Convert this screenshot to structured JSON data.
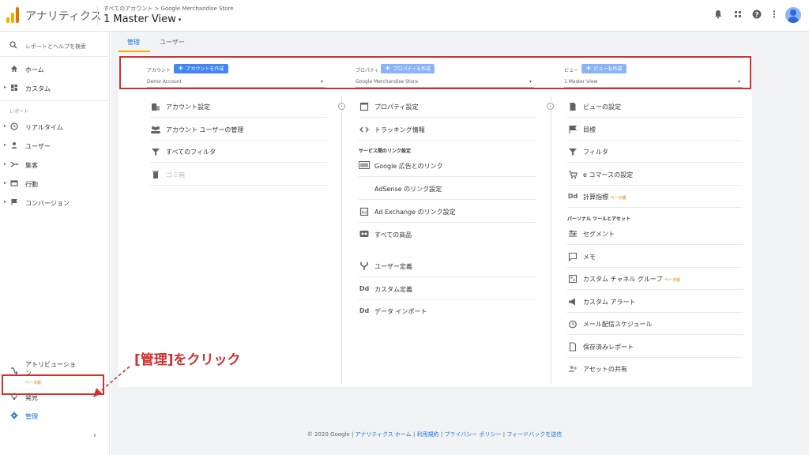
{
  "header": {
    "app_name": "アナリティクス",
    "breadcrumb": "すべてのアカウント > Google Merchandise Store",
    "view_name": "1 Master View",
    "caret": "▾",
    "icons": [
      "bell-icon",
      "apps-icon",
      "help-icon",
      "more-vert-icon",
      "account-avatar-icon"
    ],
    "colors": {
      "logo_orange": "#f9ab00",
      "logo_dark": "#e37400"
    }
  },
  "sidebar": {
    "search_label": "レポートとヘルプを検索",
    "home": "ホーム",
    "custom": "カスタム",
    "reports_section": "レポート",
    "realtime": "リアルタイム",
    "audience": "ユーザー",
    "acquisition": "集客",
    "behavior": "行動",
    "conversions": "コンバージョン",
    "attribution": "アトリビューション",
    "attribution_beta": "ベータ版",
    "discover": "発見",
    "admin": "管理",
    "collapse": "‹"
  },
  "annotation": {
    "text": "[管理]をクリック",
    "color": "#d32f2f"
  },
  "tabs": {
    "admin": "管理",
    "user": "ユーザー"
  },
  "columns": {
    "account": {
      "label": "アカウント",
      "button": "アカウントを作成",
      "selected": "Demo Account",
      "rows": [
        {
          "icon": "building-icon",
          "label": "アカウント設定"
        },
        {
          "icon": "people-icon",
          "label": "アカウント ユーザーの管理"
        },
        {
          "icon": "filter-icon",
          "label": "すべてのフィルタ"
        },
        {
          "icon": "trash-icon",
          "label": "ゴミ箱"
        }
      ]
    },
    "property": {
      "label": "プロパティ",
      "button": "プロパティを作成",
      "selected": "Google Merchandise Store",
      "rows": [
        {
          "icon": "window-icon",
          "label": "プロパティ設定"
        },
        {
          "icon": "code-icon",
          "label": "トラッキング情報"
        }
      ],
      "linking_section": "サービス間のリンク設定",
      "linking_rows": [
        {
          "icon": "ads-icon",
          "label": "Google 広告とのリンク"
        },
        {
          "icon": "",
          "label": "AdSense のリンク設定"
        },
        {
          "icon": "adx-icon",
          "label": "Ad Exchange のリンク設定"
        },
        {
          "icon": "products-icon",
          "label": "すべての商品"
        }
      ],
      "extra_rows": [
        {
          "icon": "fork-icon",
          "label": "ユーザー定義"
        },
        {
          "icon": "dd-icon",
          "label": "カスタム定義"
        },
        {
          "icon": "dd-icon",
          "label": "データ インポート"
        }
      ]
    },
    "view": {
      "label": "ビュー",
      "button": "ビューを作成",
      "selected": "1 Master View",
      "rows": [
        {
          "icon": "document-icon",
          "label": "ビューの設定"
        },
        {
          "icon": "flag-icon",
          "label": "目標"
        },
        {
          "icon": "filter-icon",
          "label": "フィルタ"
        },
        {
          "icon": "cart-icon",
          "label": "e コマースの設定"
        },
        {
          "icon": "dd-icon",
          "label": "計算指標",
          "beta": "ベータ版"
        }
      ],
      "personal_section": "パーソナル ツールとアセット",
      "personal_rows": [
        {
          "icon": "segment-icon",
          "label": "セグメント"
        },
        {
          "icon": "comment-icon",
          "label": "メモ"
        },
        {
          "icon": "channel-icon",
          "label": "カスタム チャネル グループ",
          "beta": "ベータ版"
        },
        {
          "icon": "megaphone-icon",
          "label": "カスタム アラート"
        },
        {
          "icon": "clock-icon",
          "label": "メール配信スケジュール"
        },
        {
          "icon": "saved-report-icon",
          "label": "保存済みレポート"
        },
        {
          "icon": "share-icon",
          "label": "アセットの共有"
        }
      ]
    }
  },
  "buttons_color": "#4285f4",
  "buttons_color_light": "#8ab4f8",
  "footer": {
    "copyright": "© 2020 Google",
    "links": [
      "アナリティクス ホーム",
      "利用規約",
      "プライバシー ポリシー",
      "フィードバックを送信"
    ]
  }
}
